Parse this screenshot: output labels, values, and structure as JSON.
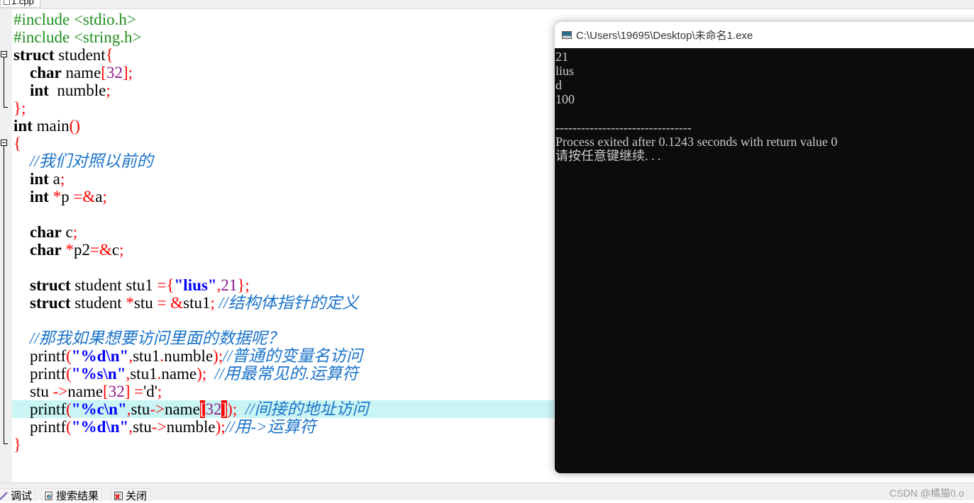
{
  "editor": {
    "tab_label": "1.cpp",
    "lines": [
      [
        {
          "t": "#include <stdio.h>",
          "c": "pp"
        }
      ],
      [
        {
          "t": "#include <string.h>",
          "c": "pp"
        }
      ],
      [
        {
          "t": "struct",
          "c": "kw"
        },
        {
          "t": " student"
        },
        {
          "t": "{",
          "c": "sym"
        }
      ],
      [
        {
          "t": "    "
        },
        {
          "t": "char",
          "c": "kw"
        },
        {
          "t": " name"
        },
        {
          "t": "[",
          "c": "sym"
        },
        {
          "t": "32",
          "c": "num"
        },
        {
          "t": "];",
          "c": "sym"
        }
      ],
      [
        {
          "t": "    "
        },
        {
          "t": "int",
          "c": "kw"
        },
        {
          "t": "  numble"
        },
        {
          "t": ";",
          "c": "sym"
        }
      ],
      [
        {
          "t": "};",
          "c": "sym"
        }
      ],
      [
        {
          "t": "int",
          "c": "kw"
        },
        {
          "t": " main"
        },
        {
          "t": "()",
          "c": "sym"
        }
      ],
      [
        {
          "t": "{",
          "c": "sym"
        }
      ],
      [
        {
          "t": "    "
        },
        {
          "t": "//我们对照以前的",
          "c": "cmt"
        }
      ],
      [
        {
          "t": "    "
        },
        {
          "t": "int",
          "c": "kw"
        },
        {
          "t": " a"
        },
        {
          "t": ";",
          "c": "sym"
        }
      ],
      [
        {
          "t": "    "
        },
        {
          "t": "int",
          "c": "kw"
        },
        {
          "t": " "
        },
        {
          "t": "*",
          "c": "sym"
        },
        {
          "t": "p "
        },
        {
          "t": "=&",
          "c": "sym"
        },
        {
          "t": "a"
        },
        {
          "t": ";",
          "c": "sym"
        }
      ],
      [
        {
          "t": ""
        }
      ],
      [
        {
          "t": "    "
        },
        {
          "t": "char",
          "c": "kw"
        },
        {
          "t": " c"
        },
        {
          "t": ";",
          "c": "sym"
        }
      ],
      [
        {
          "t": "    "
        },
        {
          "t": "char",
          "c": "kw"
        },
        {
          "t": " "
        },
        {
          "t": "*",
          "c": "sym"
        },
        {
          "t": "p2"
        },
        {
          "t": "=&",
          "c": "sym"
        },
        {
          "t": "c"
        },
        {
          "t": ";",
          "c": "sym"
        }
      ],
      [
        {
          "t": ""
        }
      ],
      [
        {
          "t": "    "
        },
        {
          "t": "struct",
          "c": "kw"
        },
        {
          "t": " student stu1 "
        },
        {
          "t": "={",
          "c": "sym"
        },
        {
          "t": "\"lius\"",
          "c": "str"
        },
        {
          "t": ",",
          "c": "sym"
        },
        {
          "t": "21",
          "c": "num"
        },
        {
          "t": "};",
          "c": "sym"
        }
      ],
      [
        {
          "t": "    "
        },
        {
          "t": "struct",
          "c": "kw"
        },
        {
          "t": " student "
        },
        {
          "t": "*",
          "c": "sym"
        },
        {
          "t": "stu "
        },
        {
          "t": "=",
          "c": "sym"
        },
        {
          "t": " "
        },
        {
          "t": "&",
          "c": "sym"
        },
        {
          "t": "stu1"
        },
        {
          "t": ";",
          "c": "sym"
        },
        {
          "t": " //结构体指针的定义",
          "c": "cmt"
        }
      ],
      [
        {
          "t": ""
        }
      ],
      [
        {
          "t": "    "
        },
        {
          "t": "//那我如果想要访问里面的数据呢？",
          "c": "cmt"
        }
      ],
      [
        {
          "t": "    printf"
        },
        {
          "t": "(",
          "c": "sym"
        },
        {
          "t": "\"",
          "c": "str"
        },
        {
          "t": "%d\\n",
          "c": "esc"
        },
        {
          "t": "\"",
          "c": "str"
        },
        {
          "t": ",",
          "c": "sym"
        },
        {
          "t": "stu1"
        },
        {
          "t": ".",
          "c": "sym"
        },
        {
          "t": "numble"
        },
        {
          "t": ");",
          "c": "sym"
        },
        {
          "t": "//普通的变量名访问",
          "c": "cmt"
        }
      ],
      [
        {
          "t": "    printf"
        },
        {
          "t": "(",
          "c": "sym"
        },
        {
          "t": "\"",
          "c": "str"
        },
        {
          "t": "%s\\n",
          "c": "esc"
        },
        {
          "t": "\"",
          "c": "str"
        },
        {
          "t": ",",
          "c": "sym"
        },
        {
          "t": "stu1"
        },
        {
          "t": ".",
          "c": "sym"
        },
        {
          "t": "name"
        },
        {
          "t": ");",
          "c": "sym"
        },
        {
          "t": "  //用最常见的.运算符",
          "c": "cmt"
        }
      ],
      [
        {
          "t": "    stu "
        },
        {
          "t": "->",
          "c": "sym"
        },
        {
          "t": "name"
        },
        {
          "t": "[",
          "c": "sym"
        },
        {
          "t": "32",
          "c": "num"
        },
        {
          "t": "] =",
          "c": "sym"
        },
        {
          "t": "'d'"
        },
        {
          "t": ";",
          "c": "sym"
        }
      ],
      [
        {
          "t": "    printf"
        },
        {
          "t": "(",
          "c": "sym"
        },
        {
          "t": "\"",
          "c": "str"
        },
        {
          "t": "%c\\n",
          "c": "esc"
        },
        {
          "t": "\"",
          "c": "str"
        },
        {
          "t": ",",
          "c": "sym"
        },
        {
          "t": "stu"
        },
        {
          "t": "->",
          "c": "sym"
        },
        {
          "t": "name"
        },
        {
          "t": "[",
          "c": "bm"
        },
        {
          "t": "32",
          "c": "num"
        },
        {
          "t": "]",
          "c": "bm"
        },
        {
          "t": ");",
          "c": "sym"
        },
        {
          "t": "  //间接的地址访问",
          "c": "cmt"
        }
      ],
      [
        {
          "t": "    printf"
        },
        {
          "t": "(",
          "c": "sym"
        },
        {
          "t": "\"",
          "c": "str"
        },
        {
          "t": "%d\\n",
          "c": "esc"
        },
        {
          "t": "\"",
          "c": "str"
        },
        {
          "t": ",",
          "c": "sym"
        },
        {
          "t": "stu"
        },
        {
          "t": "->",
          "c": "sym"
        },
        {
          "t": "numble"
        },
        {
          "t": ");",
          "c": "sym"
        },
        {
          "t": "//用->运算符",
          "c": "cmt"
        }
      ],
      [
        {
          "t": "}",
          "c": "sym"
        }
      ]
    ],
    "highlighted_line": 22
  },
  "console": {
    "title": "C:\\Users\\19695\\Desktop\\未命名1.exe",
    "output_lines": [
      "21",
      "lius",
      "d",
      "100",
      "",
      "--------------------------------",
      "Process exited after 0.1243 seconds with return value 0",
      "请按任意键继续. . ."
    ]
  },
  "bottom_tabs": [
    {
      "label": "调试",
      "icon": "debug-icon"
    },
    {
      "label": "搜索结果",
      "icon": "search-results-icon"
    },
    {
      "label": "关闭",
      "icon": "close-icon"
    }
  ],
  "watermark": "CSDN @橘猫0.o"
}
